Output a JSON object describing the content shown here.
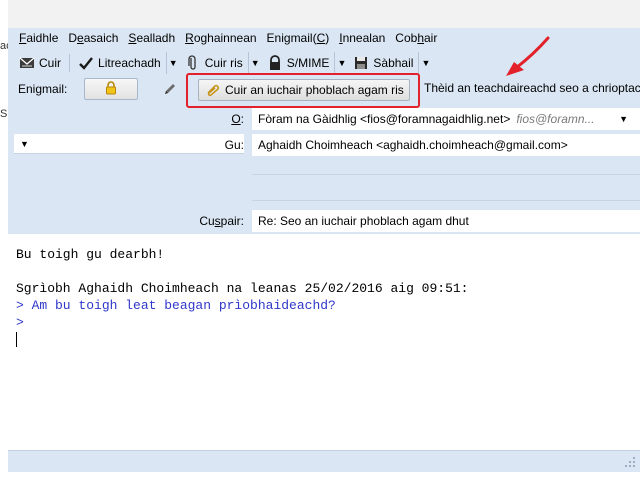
{
  "outer_fragments": [
    "ac",
    "S"
  ],
  "menu": [
    {
      "pre": "",
      "key": "F",
      "post": "aidhle"
    },
    {
      "pre": "D",
      "key": "e",
      "post": "asaich"
    },
    {
      "pre": "",
      "key": "S",
      "post": "ealladh"
    },
    {
      "pre": "",
      "key": "R",
      "post": "oghainnean"
    },
    {
      "pre": "Enigmail(",
      "key": "C",
      "post": ")"
    },
    {
      "pre": "",
      "key": "I",
      "post": "nnealan"
    },
    {
      "pre": "Cob",
      "key": "h",
      "post": "air"
    }
  ],
  "toolbar": {
    "send_label": "Cuir",
    "spell_label": "Litreachadh",
    "attach_label": "Cuir ris",
    "smime_label": "S/MIME",
    "save_label": "Sàbhail"
  },
  "enigmail": {
    "label": "Enigmail:",
    "attach_key_label": "Cuir an iuchair phoblach agam ris",
    "status_text": "Thèid an teachdaireachd seo a chrioptach"
  },
  "headers": {
    "from_label_key": "O",
    "from_label_post": ":",
    "from_value": "Fòram na Gàidhlig <fios@foramnagaidhlig.net>",
    "from_suggest": "fios@foramn...",
    "to_label": "Gu:",
    "to_value": "Aghaidh Choimheach <aghaidh.choimheach@gmail.com>",
    "subject_label_pre": "Cu",
    "subject_label_key": "s",
    "subject_label_post": "pair:",
    "subject_value": "Re: Seo an iuchair phoblach agam dhut"
  },
  "body": {
    "lines": [
      {
        "text": "Bu toigh gu dearbh!",
        "quote": false
      },
      {
        "text": "",
        "quote": false
      },
      {
        "text": "Sgrìobh Aghaidh Choimheach na leanas 25/02/2016 aig 09:51:",
        "quote": false
      },
      {
        "text": "> Am bu toigh leat beagan prìobhaideachd?",
        "quote": true
      },
      {
        "text": ">",
        "quote": true
      }
    ]
  },
  "colors": {
    "chrome_bg": "#dae6f3",
    "highlight_red": "#e3212a",
    "quote_blue": "#2f38c8"
  },
  "icons": {
    "send": "envelope-icon",
    "spell": "checkmark-icon",
    "attach": "paperclip-icon",
    "smime": "padlock-icon",
    "save": "floppy-disk-icon",
    "enigmail_lock": "gold-padlock-icon",
    "enigmail_sign": "pencil-icon",
    "attach_key": "paperclip-icon"
  }
}
